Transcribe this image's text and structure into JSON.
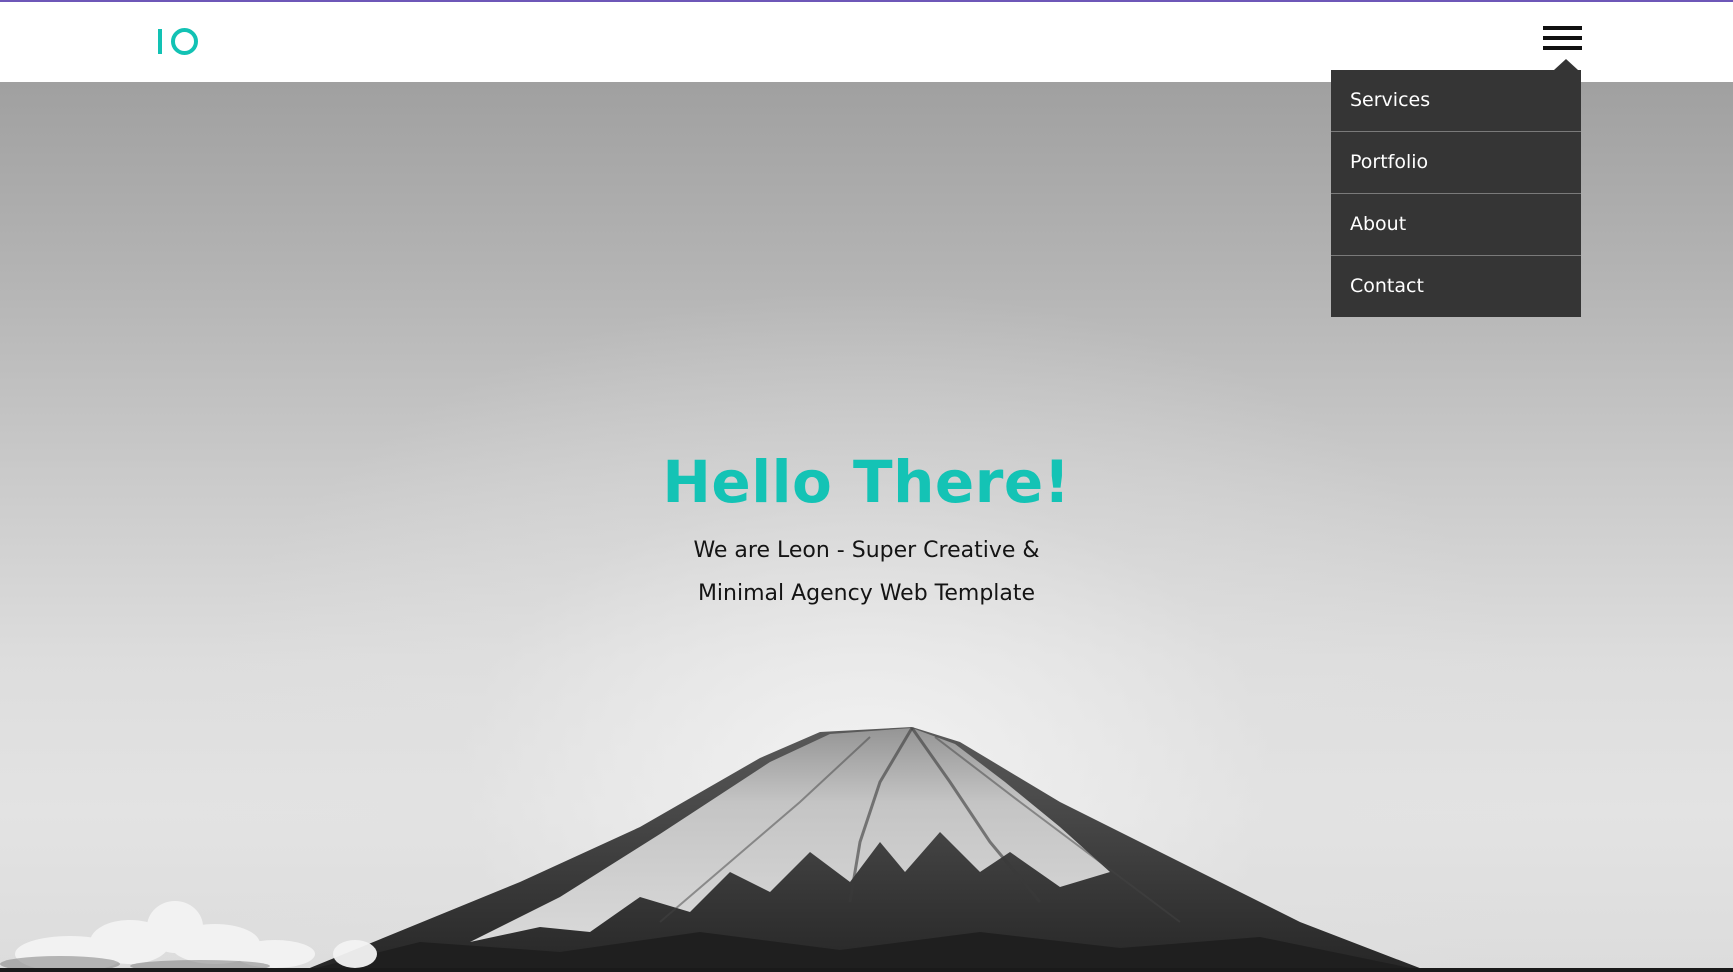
{
  "header": {
    "logo_name": "logo-io",
    "menu_icon": "hamburger-menu-icon"
  },
  "menu": {
    "items": [
      {
        "label": "Services"
      },
      {
        "label": "Portfolio"
      },
      {
        "label": "About"
      },
      {
        "label": "Contact"
      }
    ]
  },
  "hero": {
    "title": "Hello There!",
    "subtitle": "We are Leon - Super Creative & Minimal Agency Web Template"
  },
  "colors": {
    "accent": "#14c3b5",
    "top_border": "#6e57b8",
    "menu_background": "#353535",
    "menu_text": "#ffffff"
  }
}
